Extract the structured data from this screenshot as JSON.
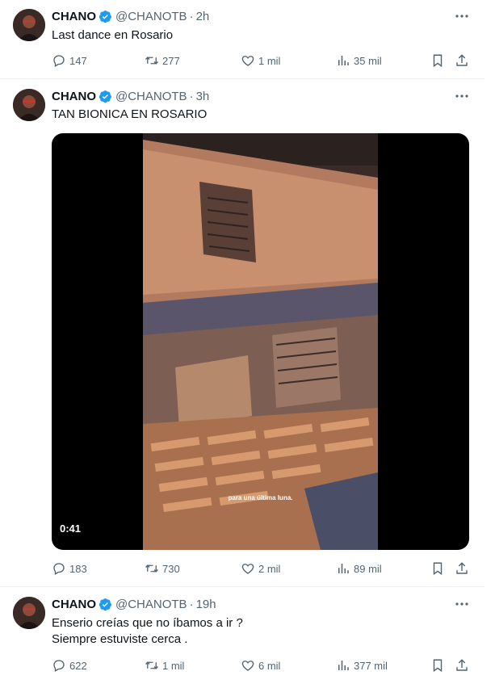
{
  "tweets": [
    {
      "name": "CHANO",
      "handle": "@CHANOTB",
      "dot": "·",
      "time": "2h",
      "text_lines": [
        "Last dance en Rosario"
      ],
      "replies": "147",
      "retweets": "277",
      "likes": "1 mil",
      "views": "35 mil"
    },
    {
      "name": "CHANO",
      "handle": "@CHANOTB",
      "dot": "·",
      "time": "3h",
      "text_lines": [
        "TAN BIONICA EN ROSARIO"
      ],
      "media": {
        "duration": "0:41",
        "caption": "para una última luna."
      },
      "replies": "183",
      "retweets": "730",
      "likes": "2 mil",
      "views": "89 mil"
    },
    {
      "name": "CHANO",
      "handle": "@CHANOTB",
      "dot": "·",
      "time": "19h",
      "text_lines": [
        "Enserio creías que no íbamos a ir ?",
        "Siempre estuviste cerca ."
      ],
      "replies": "622",
      "retweets": "1 mil",
      "likes": "6 mil",
      "views": "377 mil"
    }
  ],
  "icons": {
    "verified": "verified-badge-icon",
    "more": "more-icon",
    "reply": "reply-icon",
    "retweet": "retweet-icon",
    "like": "like-icon",
    "views": "views-icon",
    "bookmark": "bookmark-icon",
    "share": "share-icon"
  },
  "colors": {
    "accent": "#1d9bf0",
    "secondary_text": "#536471",
    "text": "#0f1419",
    "divider": "#eff3f4"
  }
}
